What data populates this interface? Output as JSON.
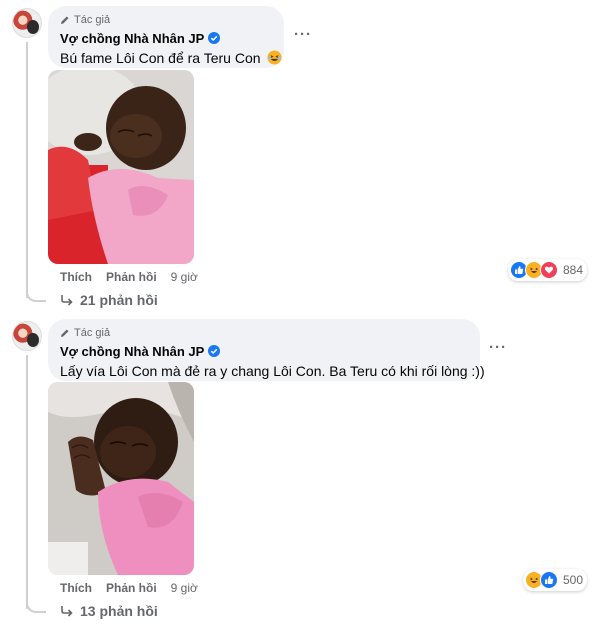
{
  "comments": [
    {
      "author_tag": "Tác giả",
      "author_name": "Vợ chồng Nhà Nhân JP",
      "text": "Bú fame Lôi Con để ra Teru Con",
      "text_emoji": "laughing-emoji",
      "image_alt": "baby sleeping in pink shirt",
      "actions": {
        "like": "Thích",
        "reply": "Phản hồi",
        "time": "9 giờ"
      },
      "reactions": {
        "icons": [
          "like",
          "haha",
          "love"
        ],
        "count": "884"
      },
      "replies_label": "21 phản hồi"
    },
    {
      "author_tag": "Tác giả",
      "author_name": "Vợ chồng Nhà Nhân JP",
      "text": "Lấy vía Lôi Con mà đẻ ra y chang Lôi Con. Ba Teru có khi rối lòng :))",
      "image_alt": "baby sleeping with hands near face",
      "actions": {
        "like": "Thích",
        "reply": "Phản hồi",
        "time": "9 giờ"
      },
      "reactions": {
        "icons": [
          "haha",
          "like"
        ],
        "count": "500"
      },
      "replies_label": "13 phản hồi"
    }
  ],
  "colors": {
    "bubble_bg": "#f0f2f5",
    "secondary_text": "#65676b",
    "verified_blue": "#1877f2",
    "like_blue": "#1877f2",
    "haha_yellow": "#f7b125",
    "love_red": "#f33e58"
  }
}
